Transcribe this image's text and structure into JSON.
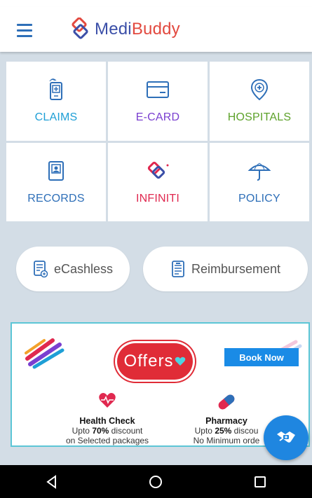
{
  "app": {
    "logo_text_prefix": "Medi",
    "logo_text_suffix": "Buddy"
  },
  "tiles": [
    {
      "label": "CLAIMS",
      "icon": "claims-phone-icon",
      "color": "#1e9fd6"
    },
    {
      "label": "E-CARD",
      "icon": "ecard-icon",
      "color": "#7a3fd0"
    },
    {
      "label": "HOSPITALS",
      "icon": "hospital-pin-icon",
      "color": "#5ea22b"
    },
    {
      "label": "RECORDS",
      "icon": "records-icon",
      "color": "#2e6fb8"
    },
    {
      "label": "INFINITI",
      "icon": "infiniti-logo-icon",
      "color": "#e0284f"
    },
    {
      "label": "POLICY",
      "icon": "umbrella-icon",
      "color": "#2e6fb8"
    }
  ],
  "actions": {
    "ecashless": "eCashless",
    "reimbursement": "Reimbursement"
  },
  "banner": {
    "offers_label": "Offers",
    "book_now": "Book Now",
    "health_title": "Health Check",
    "health_line1_pre": "Upto ",
    "health_line1_bold": "70%",
    "health_line1_post": " discount",
    "health_line2": "on Selected packages",
    "pharmacy_title": "Pharmacy",
    "pharmacy_line1_pre": "Upto ",
    "pharmacy_line1_bold": "25%",
    "pharmacy_line1_post": " discou",
    "pharmacy_line2": "No Minimum orde"
  },
  "colors": {
    "brand_blue": "#3b4fa8",
    "brand_red": "#e2493f",
    "accent_blue": "#1f86e0",
    "background": "#d3dde6"
  },
  "navbar": {
    "icons": [
      "back-triangle-icon",
      "home-circle-icon",
      "recents-square-icon"
    ]
  }
}
